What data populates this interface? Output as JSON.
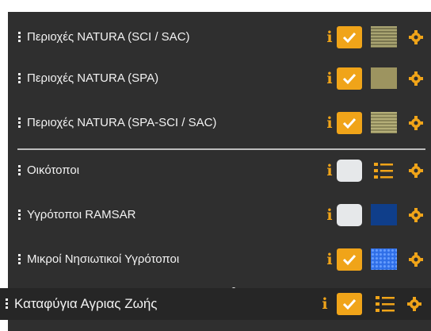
{
  "layers": [
    {
      "label": "Περιοχές NATURA (SCI / SAC)",
      "checked": true,
      "swatch": "hatch",
      "swatch_color": "#a9a472"
    },
    {
      "label": "Περιοχές NATURA (SPA)",
      "checked": true,
      "swatch": "solid",
      "swatch_color": "#9d9460"
    },
    {
      "label": "Περιοχές NATURA (SPA-SCI / SAC)",
      "checked": true,
      "swatch": "hatch",
      "swatch_color": "#b4ae78"
    },
    {
      "label": "Οικότοποι",
      "checked": false,
      "swatch": "legend",
      "swatch_color": "#f0a419"
    },
    {
      "label": "Υγρότοποι RAMSAR",
      "checked": false,
      "swatch": "solid",
      "swatch_color": "#0f3e8a"
    },
    {
      "label": "Μικροί Νησιωτικοί Υγρότοποι",
      "checked": true,
      "swatch": "pattern",
      "swatch_color": "#2f6fe8"
    }
  ],
  "bottom_layer": {
    "label": "Καταφύγια Αγριας Ζωής",
    "checked": true,
    "swatch": "legend"
  },
  "colors": {
    "accent": "#f0a419",
    "panel": "#2f2f2f"
  },
  "icons": {
    "info": "i",
    "handle": "drag-handle-icon",
    "gear": "gear-icon"
  }
}
